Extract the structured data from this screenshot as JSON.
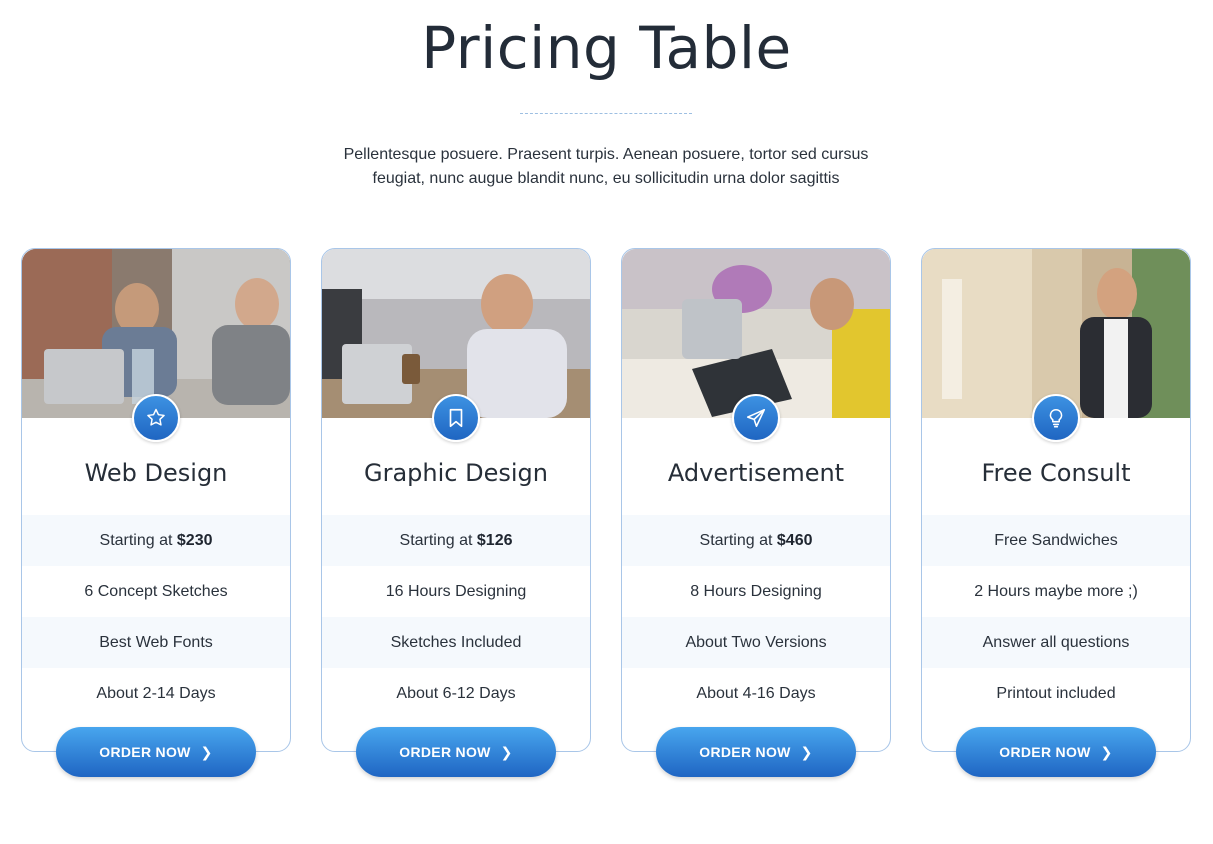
{
  "header": {
    "title": "Pricing Table",
    "subtitle_line1": "Pellentesque posuere. Praesent turpis. Aenean posuere, tortor sed cursus",
    "subtitle_line2": "feugiat, nunc augue blandit nunc, eu sollicitudin urna dolor sagittis"
  },
  "colors": {
    "accent": "#2e7fd6",
    "border": "#a9c6e8",
    "title": "#232c38"
  },
  "cards": [
    {
      "icon": "star-icon",
      "title": "Web Design",
      "price_prefix": "Starting at ",
      "price": "$230",
      "features": [
        "6 Concept Sketches",
        "Best Web Fonts",
        "About 2-14 Days"
      ],
      "button": "ORDER NOW"
    },
    {
      "icon": "bookmark-icon",
      "title": "Graphic Design",
      "price_prefix": "Starting at ",
      "price": "$126",
      "features": [
        "16 Hours Designing",
        "Sketches Included",
        "About 6-12 Days"
      ],
      "button": "ORDER NOW"
    },
    {
      "icon": "paper-plane-icon",
      "title": "Advertisement",
      "price_prefix": "Starting at ",
      "price": "$460",
      "features": [
        "8 Hours Designing",
        "About Two Versions",
        "About 4-16 Days"
      ],
      "button": "ORDER NOW"
    },
    {
      "icon": "lightbulb-icon",
      "title": "Free Consult",
      "price_prefix": "Free Sandwiches",
      "price": "",
      "features": [
        "2 Hours maybe more ;)",
        "Answer all questions",
        "Printout included"
      ],
      "button": "ORDER NOW"
    }
  ]
}
